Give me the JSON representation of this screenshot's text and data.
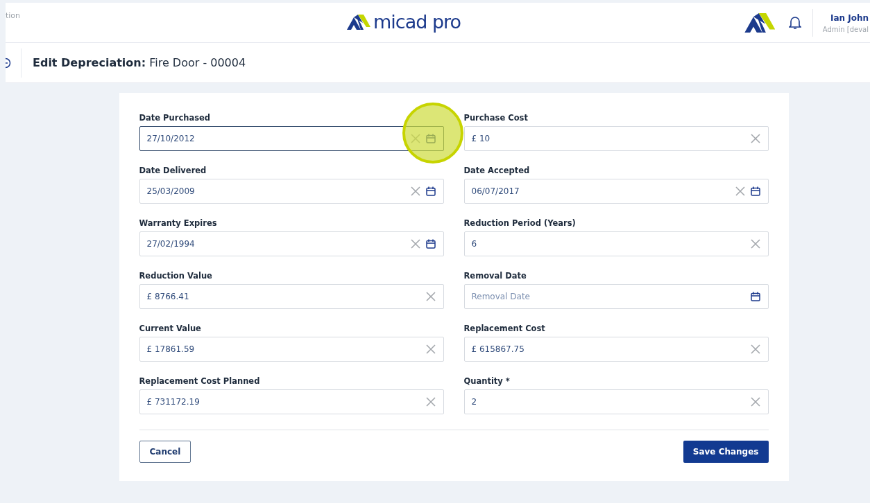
{
  "header": {
    "left_text": "tion",
    "logo_text": "micad pro",
    "user": {
      "name": "Ian John",
      "role": "Admin [deval"
    }
  },
  "page": {
    "title_bold": "Edit Depreciation:",
    "title_rest": "Fire Door - 00004"
  },
  "form": {
    "fields": [
      {
        "label": "Date Purchased",
        "value": "27/10/2012",
        "clear": true,
        "calendar": true,
        "focused": true,
        "highlighted": true
      },
      {
        "label": "Purchase Cost",
        "value": "£ 10",
        "clear": true,
        "calendar": false,
        "focused": false,
        "highlighted": false
      },
      {
        "label": "Date Delivered",
        "value": "25/03/2009",
        "clear": true,
        "calendar": true,
        "focused": false,
        "highlighted": false
      },
      {
        "label": "Date Accepted",
        "value": "06/07/2017",
        "clear": true,
        "calendar": true,
        "focused": false,
        "highlighted": false
      },
      {
        "label": "Warranty Expires",
        "value": "27/02/1994",
        "clear": true,
        "calendar": true,
        "focused": false,
        "highlighted": false
      },
      {
        "label": "Reduction Period (Years)",
        "value": "6",
        "clear": true,
        "calendar": false,
        "focused": false,
        "highlighted": false
      },
      {
        "label": "Reduction Value",
        "value": "£ 8766.41",
        "clear": true,
        "calendar": false,
        "focused": false,
        "highlighted": false
      },
      {
        "label": "Removal Date",
        "placeholder": "Removal Date",
        "clear": false,
        "calendar": true,
        "focused": false,
        "highlighted": false
      },
      {
        "label": "Current Value",
        "value": "£ 17861.59",
        "clear": true,
        "calendar": false,
        "focused": false,
        "highlighted": false
      },
      {
        "label": "Replacement Cost",
        "value": "£ 615867.75",
        "clear": true,
        "calendar": false,
        "focused": false,
        "highlighted": false
      },
      {
        "label": "Replacement Cost Planned",
        "value": "£ 731172.19",
        "clear": true,
        "calendar": false,
        "focused": false,
        "highlighted": false
      },
      {
        "label": "Quantity *",
        "value": "2",
        "clear": true,
        "calendar": false,
        "focused": false,
        "highlighted": false
      }
    ],
    "buttons": {
      "cancel": "Cancel",
      "save": "Save Changes"
    }
  }
}
